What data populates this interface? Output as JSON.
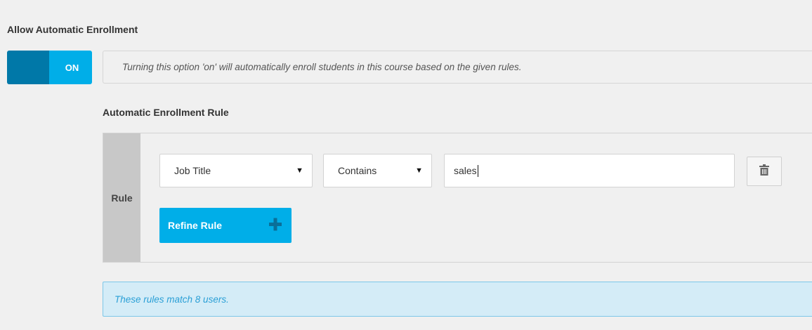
{
  "settings": {
    "title": "Allow Automatic Enrollment",
    "toggle": {
      "state_label": "ON",
      "is_on": true
    },
    "help_text": "Turning this option 'on' will automatically enroll students in this course based on the given rules."
  },
  "rules": {
    "heading": "Automatic Enrollment Rule",
    "rule_label": "Rule",
    "field_select": {
      "value": "Job Title"
    },
    "operator_select": {
      "value": "Contains"
    },
    "value_input": {
      "value": "sales"
    },
    "refine_button_label": "Refine Rule",
    "match_text": "These rules match 8 users."
  },
  "icons": {
    "dropdown": "chevron-down-icon",
    "delete": "trash-icon",
    "add": "plus-icon"
  },
  "colors": {
    "accent": "#00aee8",
    "accent_dark": "#0078a8",
    "info_bg": "#d4ecf7",
    "info_text": "#2a9fd6",
    "rule_label_bg": "#c8c8c8"
  }
}
